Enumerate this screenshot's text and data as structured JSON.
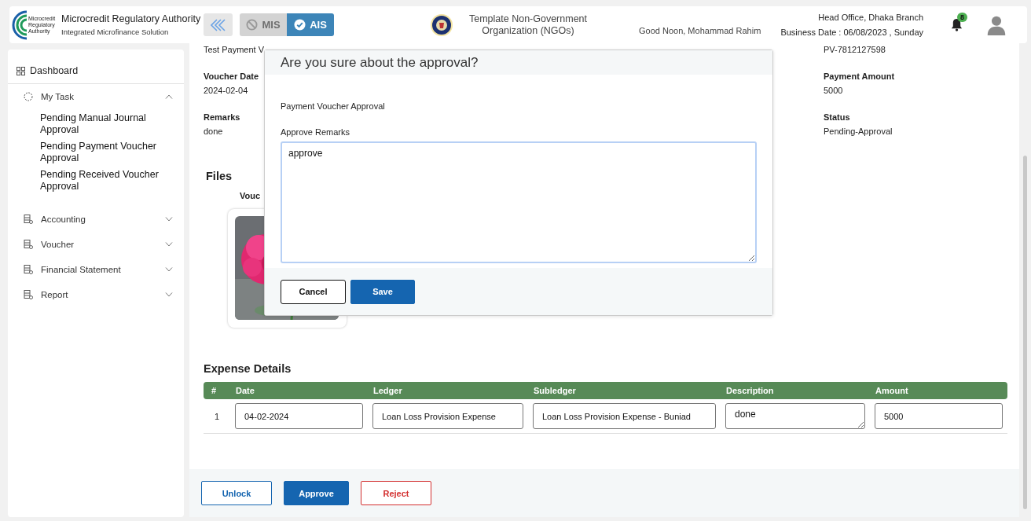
{
  "header": {
    "org_title": "Microcredit Regulatory Authority",
    "org_subtitle": "Integrated Microfinance Solution",
    "logo_text": [
      "Microcredit",
      "Regulatory",
      "Authority"
    ],
    "mode_toggle": [
      {
        "label": "MIS",
        "selected": false
      },
      {
        "label": "AIS",
        "selected": true
      }
    ],
    "org_name": "Template Non-Government Organization (NGOs)",
    "greeting": "Good Noon, Mohammad Rahim",
    "branch": "Head Office, Dhaka Branch",
    "business_date": "Business Date : 06/08/2023 , Sunday",
    "notification_count": "8"
  },
  "sidebar": {
    "items": [
      {
        "label": "Dashboard",
        "kind": "link"
      },
      {
        "label": "My Task",
        "kind": "group",
        "expanded": true,
        "children": [
          {
            "label": "Pending Manual Journal Approval"
          },
          {
            "label": "Pending Payment Voucher Approval"
          },
          {
            "label": "Pending Received Voucher Approval"
          }
        ]
      },
      {
        "label": "Accounting",
        "kind": "group",
        "expanded": false
      },
      {
        "label": "Voucher",
        "kind": "group",
        "expanded": false
      },
      {
        "label": "Financial Statement",
        "kind": "group",
        "expanded": false
      },
      {
        "label": "Report",
        "kind": "group",
        "expanded": false
      }
    ]
  },
  "details": {
    "rows": [
      {
        "left": {
          "value": "Test Payment V"
        },
        "right": {
          "value": "PV-7812127598"
        }
      },
      {
        "left": {
          "label": "Voucher Date",
          "value": "2024-02-04"
        },
        "right": {
          "label": "Payment Amount",
          "value": "5000"
        }
      },
      {
        "left": {
          "label": "Remarks",
          "value": "done"
        },
        "right": {
          "label": "Status",
          "value": "Pending-Approval"
        }
      }
    ]
  },
  "files": {
    "heading": "Files",
    "caption": "Vouc"
  },
  "expense": {
    "title": "Expense Details",
    "columns": [
      "#",
      "Date",
      "Ledger",
      "Subledger",
      "Description",
      "Amount"
    ],
    "rows": [
      {
        "index": "1",
        "date": "04-02-2024",
        "ledger": "Loan Loss Provision Expense",
        "subledger": "Loan Loss Provision Expense - Buniad",
        "description": "done",
        "amount": "5000"
      }
    ]
  },
  "actions": [
    {
      "label": "Unlock",
      "kind": "outline"
    },
    {
      "label": "Approve",
      "kind": "primary"
    },
    {
      "label": "Reject",
      "kind": "danger"
    }
  ],
  "modal": {
    "title": "Are you sure about the approval?",
    "subtitle": "Payment Voucher Approval",
    "field_label": "Approve Remarks",
    "remarks": "approve",
    "buttons": [
      {
        "label": "Cancel",
        "kind": "outline"
      },
      {
        "label": "Save",
        "kind": "primary"
      }
    ]
  }
}
